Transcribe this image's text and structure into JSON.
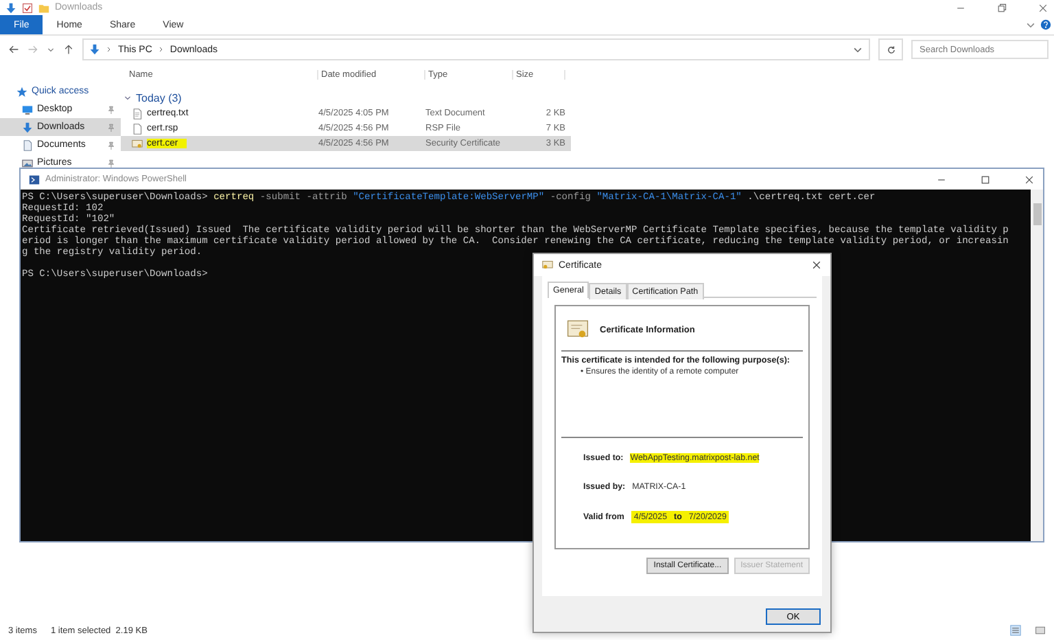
{
  "explorer": {
    "title": "Downloads",
    "ribbon_tabs": [
      {
        "label": "File",
        "selected": true
      },
      {
        "label": "Home",
        "selected": false
      },
      {
        "label": "Share",
        "selected": false
      },
      {
        "label": "View",
        "selected": false
      }
    ],
    "path": [
      "This PC",
      "Downloads"
    ],
    "search": {
      "placeholder": "Search Downloads"
    },
    "sidebar": [
      {
        "label": "Quick access",
        "kind": "header",
        "selected": false,
        "pinned": false
      },
      {
        "label": "Desktop",
        "kind": "desktop",
        "selected": false,
        "pinned": true
      },
      {
        "label": "Downloads",
        "kind": "downloads",
        "selected": true,
        "pinned": true
      },
      {
        "label": "Documents",
        "kind": "documents",
        "selected": false,
        "pinned": true
      },
      {
        "label": "Pictures",
        "kind": "pictures",
        "selected": false,
        "pinned": true
      }
    ],
    "columns": [
      "Name",
      "Date modified",
      "Type",
      "Size"
    ],
    "group": "Today (3)",
    "files": [
      {
        "name": "certreq.txt",
        "date": "4/5/2025 4:05 PM",
        "type": "Text Document",
        "size": "2 KB",
        "kind": "text",
        "selected": false,
        "highlighted": false
      },
      {
        "name": "cert.rsp",
        "date": "4/5/2025 4:56 PM",
        "type": "RSP File",
        "size": "7 KB",
        "kind": "file",
        "selected": false,
        "highlighted": false
      },
      {
        "name": "cert.cer",
        "date": "4/5/2025 4:56 PM",
        "type": "Security Certificate",
        "size": "3 KB",
        "kind": "cert",
        "selected": true,
        "highlighted": true
      }
    ],
    "status": [
      "3 items",
      "1 item selected  2.19 KB"
    ]
  },
  "powershell": {
    "title": "Administrator: Windows PowerShell",
    "lines": [
      [
        {
          "kind": "plain",
          "text": "PS C:\\Users\\superuser\\Downloads> "
        },
        {
          "kind": "command",
          "text": "certreq"
        },
        {
          "kind": "param",
          "text": " -submit -attrib "
        },
        {
          "kind": "string",
          "text": "\"CertificateTemplate:WebServerMP\""
        },
        {
          "kind": "param",
          "text": " -config "
        },
        {
          "kind": "string",
          "text": "\"Matrix-CA-1\\Matrix-CA-1\""
        },
        {
          "kind": "plain",
          "text": " .\\certreq.txt cert.cer"
        }
      ],
      [
        {
          "kind": "plain",
          "text": "RequestId: 102"
        }
      ],
      [
        {
          "kind": "plain",
          "text": "RequestId: \"102\""
        }
      ],
      [
        {
          "kind": "plain",
          "text": "Certificate retrieved(Issued) Issued  The certificate validity period will be shorter than the WebServerMP Certificate Template specifies, because the template validity p"
        }
      ],
      [
        {
          "kind": "plain",
          "text": "eriod is longer than the maximum certificate validity period allowed by the CA.  Consider renewing the CA certificate, reducing the template validity period, or increasin"
        }
      ],
      [
        {
          "kind": "plain",
          "text": "g the registry validity period."
        }
      ],
      [
        {
          "kind": "blank"
        }
      ],
      [
        {
          "kind": "plain",
          "text": "PS C:\\Users\\superuser\\Downloads> "
        }
      ]
    ]
  },
  "certificate": {
    "title": "Certificate",
    "tabs": [
      {
        "label": "General",
        "selected": true
      },
      {
        "label": "Details",
        "selected": false
      },
      {
        "label": "Certification Path",
        "selected": false
      }
    ],
    "heading": "Certificate Information",
    "purpose_heading": "This certificate is intended for the following purpose(s):",
    "purposes": [
      {
        "bullet": "•",
        "text": "Ensures the identity of a remote computer"
      }
    ],
    "issued_to": {
      "label": "Issued to:",
      "value": "WebAppTesting.matrixpost-lab.net",
      "highlighted": true
    },
    "issued_by": {
      "label": "Issued by:",
      "value": "MATRIX-CA-1",
      "highlighted": false
    },
    "valid": {
      "label": "Valid from",
      "from": "4/5/2025",
      "to_label": "to",
      "to": "7/20/2029",
      "highlighted": true
    },
    "buttons": [
      {
        "label": "Install Certificate...",
        "disabled": false
      },
      {
        "label": "Issuer Statement",
        "disabled": true
      }
    ],
    "ok": "OK"
  }
}
